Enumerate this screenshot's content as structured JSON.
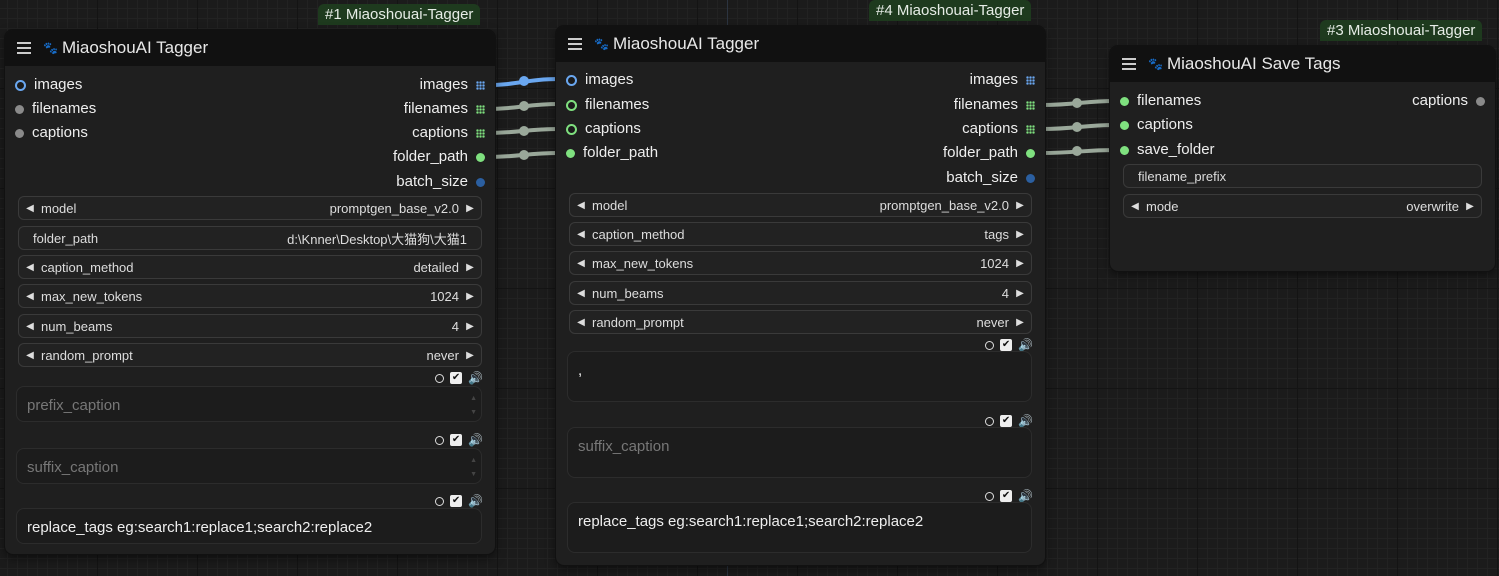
{
  "colors": {
    "link_image": "#6aa7f0",
    "link_string": "#9aa89a",
    "slot_string": "#7fe07f",
    "slot_image": "#6aa7f0",
    "slot_int": "#2b5fa0"
  },
  "n1": {
    "badge": "#1 Miaoshouai-Tagger",
    "title": "MiaoshouAI Tagger",
    "inputs": [
      "images",
      "filenames",
      "captions"
    ],
    "outputs": [
      "images",
      "filenames",
      "captions",
      "folder_path",
      "batch_size"
    ],
    "model": {
      "label": "model",
      "value": "promptgen_base_v2.0"
    },
    "folder_path": {
      "label": "folder_path",
      "value": "d:\\Knner\\Desktop\\大猫狗\\大猫1"
    },
    "caption_method": {
      "label": "caption_method",
      "value": "detailed"
    },
    "max_new_tokens": {
      "label": "max_new_tokens",
      "value": "1024"
    },
    "num_beams": {
      "label": "num_beams",
      "value": "4"
    },
    "random_prompt": {
      "label": "random_prompt",
      "value": "never"
    },
    "prefix_caption": "prefix_caption",
    "suffix_caption": "suffix_caption",
    "replace_tags": "replace_tags eg:search1:replace1;search2:replace2"
  },
  "n4": {
    "badge": "#4 Miaoshouai-Tagger",
    "title": "MiaoshouAI Tagger",
    "inputs": [
      "images",
      "filenames",
      "captions",
      "folder_path"
    ],
    "outputs": [
      "images",
      "filenames",
      "captions",
      "folder_path",
      "batch_size"
    ],
    "model": {
      "label": "model",
      "value": "promptgen_base_v2.0"
    },
    "caption_method": {
      "label": "caption_method",
      "value": "tags"
    },
    "max_new_tokens": {
      "label": "max_new_tokens",
      "value": "1024"
    },
    "num_beams": {
      "label": "num_beams",
      "value": "4"
    },
    "random_prompt": {
      "label": "random_prompt",
      "value": "never"
    },
    "prefix_value": ",",
    "suffix_caption": "suffix_caption",
    "replace_tags": "replace_tags eg:search1:replace1;search2:replace2"
  },
  "n3": {
    "badge": "#3 Miaoshouai-Tagger",
    "title": "MiaoshouAI Save Tags",
    "inputs": [
      "filenames",
      "captions",
      "save_folder"
    ],
    "outputs": [
      "captions"
    ],
    "filename_prefix": "filename_prefix",
    "mode": {
      "label": "mode",
      "value": "overwrite"
    }
  }
}
